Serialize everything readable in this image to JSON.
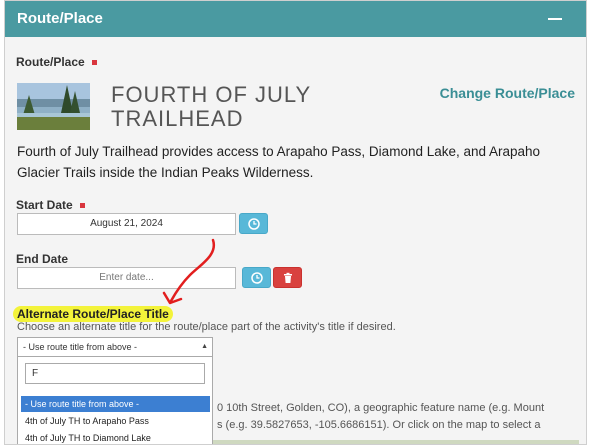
{
  "panel": {
    "title": "Route/Place"
  },
  "route_place": {
    "label": "Route/Place",
    "title_line1": "FOURTH OF JULY",
    "title_line2": "TRAILHEAD",
    "change_label": "Change Route/Place",
    "description": "Fourth of July Trailhead provides access to Arapaho Pass, Diamond Lake, and Arapaho Glacier Trails inside the Indian Peaks Wilderness."
  },
  "start_date": {
    "label": "Start Date",
    "value": "August 21, 2024"
  },
  "end_date": {
    "label": "End Date",
    "placeholder": "Enter date..."
  },
  "alternate_title": {
    "label": "Alternate Route/Place Title",
    "help": "Choose an alternate title for the route/place part of the activity's title if desired.",
    "selected": "- Use route title from above -",
    "search_value": "F",
    "options": [
      "- Use route title from above -",
      "4th of July TH to Arapaho Pass",
      "4th of July TH to Diamond Lake"
    ]
  },
  "hidden_text": {
    "line1": "0 10th Street, Golden, CO), a geographic feature name (e.g. Mount",
    "line2": "s (e.g. 39.5827653, -105.6686151). Or click on the map to select a"
  },
  "colors": {
    "header": "#4a9aa1",
    "accent": "#3a8e95",
    "required": "#d9363e",
    "highlight": "#f3f33a",
    "annotation": "#e21e1e"
  },
  "icons": [
    "minus-icon",
    "clock-icon",
    "trash-icon",
    "chevron-down-icon",
    "trailhead-photo"
  ]
}
